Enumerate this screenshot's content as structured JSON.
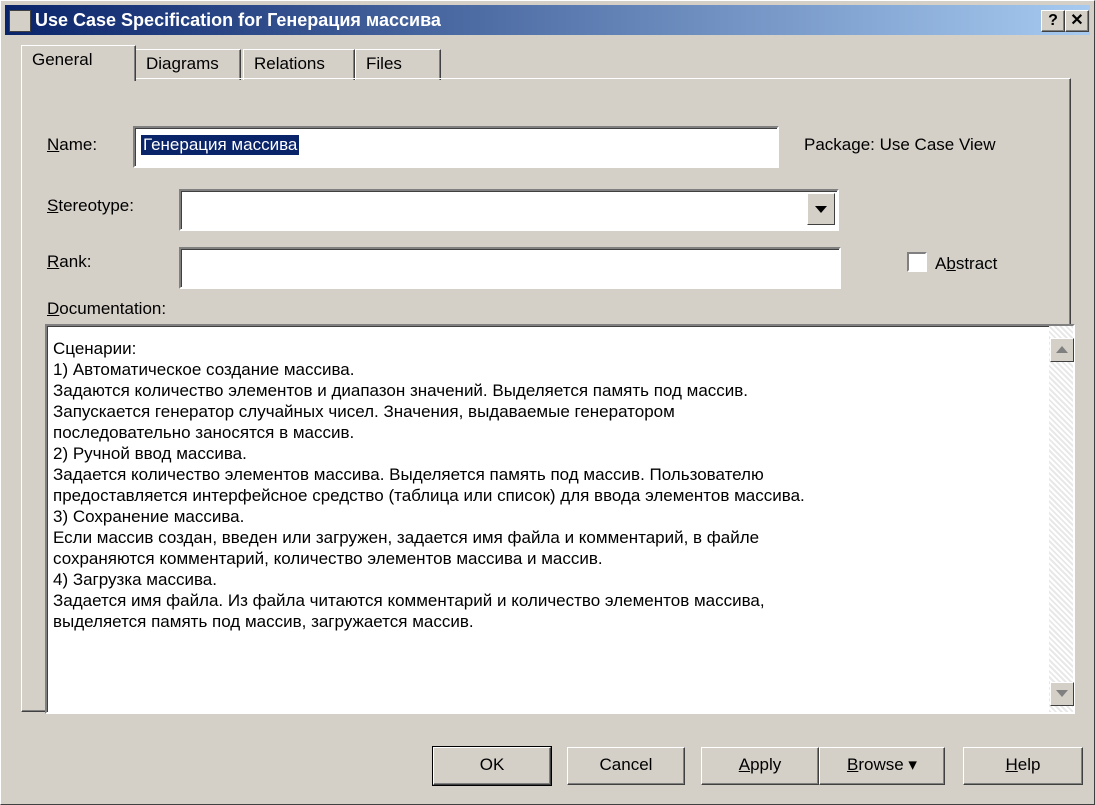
{
  "window": {
    "title": "Use Case Specification for Генерация массива",
    "help_button": "?",
    "close_button": "✕"
  },
  "tabs": [
    {
      "label": "General",
      "active": true
    },
    {
      "label": "Diagrams",
      "active": false
    },
    {
      "label": "Relations",
      "active": false
    },
    {
      "label": "Files",
      "active": false
    }
  ],
  "general": {
    "name_label_mnemonic": "N",
    "name_label_rest": "ame:",
    "name_value": "Генерация массива",
    "package_text": "Package:  Use Case View",
    "stereotype_label_mnemonic": "S",
    "stereotype_label_rest": "tereotype:",
    "stereotype_value": "",
    "rank_label_mnemonic": "R",
    "rank_label_rest": "ank:",
    "rank_value": "",
    "abstract_label_pre": "A",
    "abstract_label_mnemonic": "b",
    "abstract_label_rest": "stract",
    "abstract_checked": false,
    "documentation_label_mnemonic": "D",
    "documentation_label_rest": "ocumentation:",
    "documentation_text": "Сценарии:\n1) Автоматическое создание массива.\nЗадаются количество элементов и диапазон значений. Выделяется память под массив.\nЗапускается генератор случайных чисел. Значения, выдаваемые генератором\nпоследовательно заносятся в массив.\n2) Ручной ввод массива.\nЗадается количество элементов массива. Выделяется память под массив. Пользователю\nпредоставляется интерфейсное средство (таблица или список) для ввода элементов массива.\n3) Сохранение массива.\nЕсли массив создан, введен или загружен, задается имя файла и комментарий, в файле\nсохраняются комментарий, количество элементов массива и массив.\n4) Загрузка массива.\nЗадается имя файла. Из файла читаются комментарий и количество элементов массива,\nвыделяется память под массив, загружается массив."
  },
  "buttons": {
    "ok": "OK",
    "cancel": "Cancel",
    "apply_mnemonic": "A",
    "apply_rest": "pply",
    "browse_mnemonic": "B",
    "browse_rest": "rowse ▾",
    "help_mnemonic": "H",
    "help_rest": "elp"
  }
}
